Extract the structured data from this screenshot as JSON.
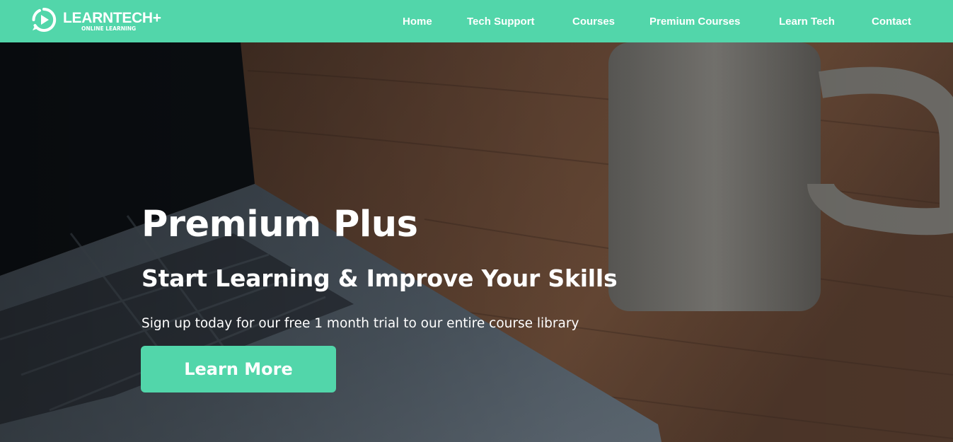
{
  "brand": {
    "name": "LEARNTECH+",
    "tagline": "ONLINE LEARNING",
    "accent_color": "#52d6aa",
    "icon": "play-circle-icon"
  },
  "nav": {
    "items": [
      {
        "label": "Home"
      },
      {
        "label": "Tech Support"
      },
      {
        "label": "Courses"
      },
      {
        "label": "Premium Courses"
      },
      {
        "label": "Learn Tech"
      },
      {
        "label": "Contact"
      }
    ]
  },
  "hero": {
    "title": "Premium Plus",
    "subtitle": "Start Learning & Improve Your Skills",
    "description": "Sign up today for our free 1 month trial to our entire course library",
    "cta_label": "Learn More"
  }
}
